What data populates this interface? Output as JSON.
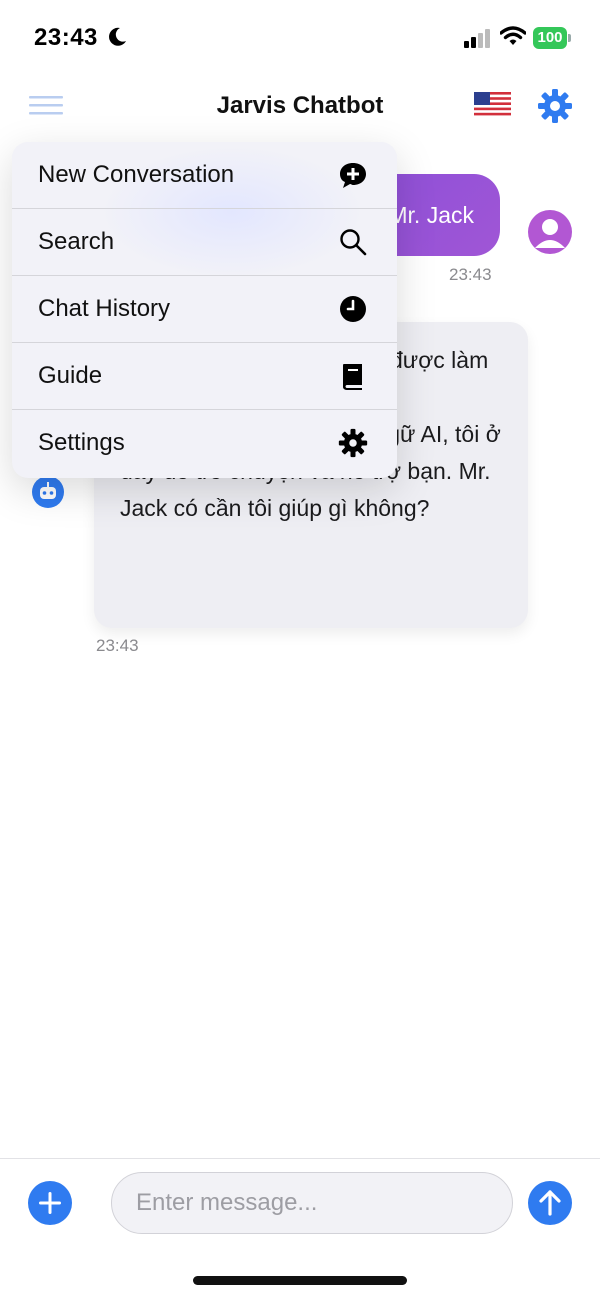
{
  "status_bar": {
    "time": "23:43",
    "battery": "100"
  },
  "header": {
    "title": "Jarvis Chatbot"
  },
  "chat": {
    "user_message": "Mr. Jack",
    "user_time": "23:43",
    "bot_message_visible_top": "được làm",
    "bot_message_visible_rest": "Tôi là một mô hình ngôn ngữ AI, tôi ở đây để trò chuyện và hỗ trợ bạn. Mr. Jack có cần tôi giúp gì không?",
    "bot_time": "23:43"
  },
  "menu": {
    "items": [
      {
        "label": "New Conversation",
        "icon": "chat-plus-icon"
      },
      {
        "label": "Search",
        "icon": "search-icon"
      },
      {
        "label": "Chat History",
        "icon": "clock-icon"
      },
      {
        "label": "Guide",
        "icon": "book-icon"
      },
      {
        "label": "Settings",
        "icon": "gear-icon"
      }
    ]
  },
  "composer": {
    "placeholder": "Enter message..."
  },
  "colors": {
    "accent_blue": "#2f7bf0",
    "user_bubble": "#9552d7",
    "battery_green": "#34c759"
  }
}
